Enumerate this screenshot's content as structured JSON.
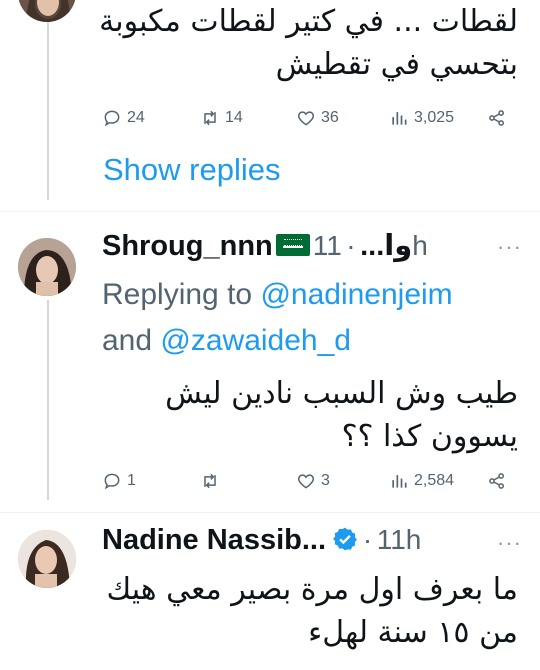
{
  "tweet1": {
    "text_line1": "لقطات ... في كتير لقطات مكبوبة",
    "text_line2": "بتحسي في تقطيش",
    "replies": "24",
    "retweets": "14",
    "likes": "36",
    "views": "3,025",
    "show_replies": "Show replies"
  },
  "tweet2": {
    "name": "Shroug_nnn",
    "name_suffix": "وا...",
    "dot": "·",
    "time": "11h",
    "more": "···",
    "replying_prefix": "Replying to",
    "mention1": "@nadinenjeim",
    "and": "and",
    "mention2": "@zawaideh_d",
    "text_line1": "طيب وش السبب نادين ليش",
    "text_line2": "يسوون كذا ؟؟",
    "replies": "1",
    "retweets": "",
    "likes": "3",
    "views": "2,584"
  },
  "tweet3": {
    "name": "Nadine Nassib...",
    "dot": "·",
    "time": "11h",
    "more": "···",
    "text_line1": "ما بعرف اول مرة بصير معي هيك",
    "text_line2": "من ١٥ سنة لهلء"
  },
  "colors": {
    "accent": "#1d9bf0",
    "muted": "#536471",
    "text": "#0f1419",
    "verified": "#1d9bf0"
  },
  "icons": {
    "reply": "speech-bubble-icon",
    "retweet": "retweet-icon",
    "like": "heart-icon",
    "views": "bar-chart-icon",
    "share": "share-icon"
  }
}
